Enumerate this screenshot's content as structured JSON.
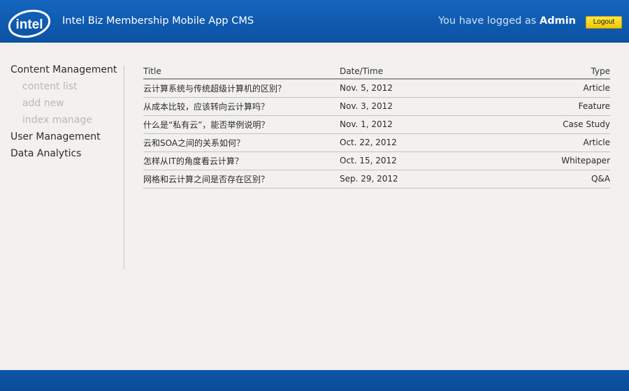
{
  "header": {
    "logo_text": "intel",
    "app_title": "Intel Biz Membership Mobile App CMS",
    "login_prefix": "You have logged as",
    "username": "Admin",
    "logout_label": "Logout",
    "brand_color": "#0b5ab0",
    "logout_color": "#f7d500"
  },
  "sidebar": {
    "content_management": "Content Management",
    "sub_items": [
      "content list",
      "add new",
      "index manage"
    ],
    "user_management": "User Management",
    "data_analytics": "Data Analytics"
  },
  "table": {
    "headers": {
      "title": "Title",
      "date": "Date/Time",
      "type": "Type"
    },
    "rows": [
      {
        "title": "云计算系统与传统超级计算机的区别？",
        "date": "Nov. 5, 2012",
        "type": "Article"
      },
      {
        "title": "从成本比较，应该转向云计算吗？",
        "date": "Nov. 3, 2012",
        "type": "Feature"
      },
      {
        "title": "什么是“私有云”，能否举例说明？",
        "date": "Nov. 1, 2012",
        "type": "Case Study"
      },
      {
        "title": "云和SOA之间的关系如何？",
        "date": "Oct. 22, 2012",
        "type": "Article"
      },
      {
        "title": "怎样从IT的角度看云计算？",
        "date": "Oct. 15, 2012",
        "type": "Whitepaper"
      },
      {
        "title": "网格和云计算之间是否存在区别？",
        "date": "Sep. 29, 2012",
        "type": "Q&A"
      }
    ]
  }
}
